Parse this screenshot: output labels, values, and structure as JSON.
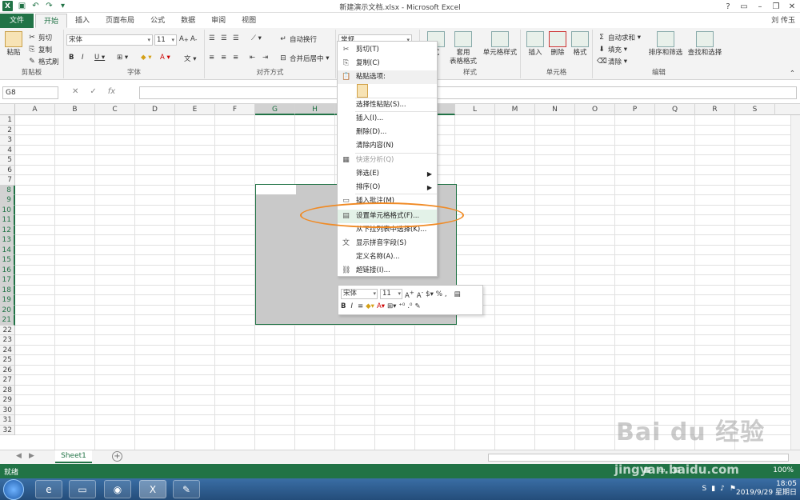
{
  "window": {
    "title": "新建演示文档.xlsx - Microsoft Excel",
    "user": "刘 传玉"
  },
  "tabs": [
    "文件",
    "开始",
    "插入",
    "页面布局",
    "公式",
    "数据",
    "审阅",
    "视图"
  ],
  "ribbon": {
    "clipboard": {
      "paste": "粘贴",
      "cut": "剪切",
      "copy": "复制",
      "format_painter": "格式刷",
      "label": "剪贴板"
    },
    "font": {
      "name": "宋体",
      "size": "11",
      "label": "字体"
    },
    "align": {
      "wrap": "自动换行",
      "merge": "合并后居中",
      "label": "对齐方式"
    },
    "number": {
      "format": "常规"
    },
    "styles": {
      "cond": "式",
      "table": "套用\n表格格式",
      "cell": "单元格样式",
      "label": "样式"
    },
    "cells": {
      "insert": "插入",
      "delete": "删除",
      "format": "格式",
      "label": "单元格"
    },
    "editing": {
      "autosum": "自动求和",
      "fill": "填充",
      "clear": "清除",
      "sort": "排序和筛选",
      "find": "查找和选择",
      "label": "编辑"
    }
  },
  "formula": {
    "namebox": "G8",
    "fx": "fx"
  },
  "columns": [
    "A",
    "B",
    "C",
    "D",
    "E",
    "F",
    "G",
    "H",
    "I",
    "J",
    "K",
    "L",
    "M",
    "N",
    "O",
    "P",
    "Q",
    "R",
    "S"
  ],
  "rows": [
    "1",
    "2",
    "3",
    "4",
    "5",
    "6",
    "7",
    "8",
    "9",
    "10",
    "11",
    "12",
    "13",
    "14",
    "15",
    "16",
    "17",
    "18",
    "19",
    "20",
    "21",
    "22",
    "23",
    "24",
    "25",
    "26",
    "27",
    "28",
    "29",
    "30",
    "31",
    "32"
  ],
  "context_menu": [
    {
      "label": "剪切(T)",
      "icon": "scissors-icon",
      "glyph": "✂",
      "state": "normal"
    },
    {
      "label": "复制(C)",
      "icon": "copy-icon",
      "glyph": "⎘",
      "state": "normal"
    },
    {
      "label": "粘贴选项:",
      "icon": "paste-icon",
      "glyph": "📋",
      "state": "header"
    },
    {
      "label": "选择性粘贴(S)...",
      "icon": "",
      "glyph": "",
      "state": "normal"
    },
    {
      "label": "插入(I)...",
      "icon": "",
      "glyph": "",
      "state": "normal"
    },
    {
      "label": "删除(D)...",
      "icon": "",
      "glyph": "",
      "state": "normal"
    },
    {
      "label": "清除内容(N)",
      "icon": "",
      "glyph": "",
      "state": "normal"
    },
    {
      "label": "快速分析(Q)",
      "icon": "quick-analysis-icon",
      "glyph": "▦",
      "state": "disabled"
    },
    {
      "label": "筛选(E)",
      "icon": "",
      "glyph": "",
      "state": "submenu"
    },
    {
      "label": "排序(O)",
      "icon": "",
      "glyph": "",
      "state": "submenu"
    },
    {
      "label": "插入批注(M)",
      "icon": "comment-icon",
      "glyph": "▭",
      "state": "normal"
    },
    {
      "label": "设置单元格格式(F)...",
      "icon": "format-cells-icon",
      "glyph": "▤",
      "state": "highlight"
    },
    {
      "label": "从下拉列表中选择(K)...",
      "icon": "",
      "glyph": "",
      "state": "normal"
    },
    {
      "label": "显示拼音字段(S)",
      "icon": "phonetic-icon",
      "glyph": "文",
      "state": "normal"
    },
    {
      "label": "定义名称(A)...",
      "icon": "",
      "glyph": "",
      "state": "normal"
    },
    {
      "label": "超链接(I)...",
      "icon": "hyperlink-icon",
      "glyph": "⛓",
      "state": "normal"
    }
  ],
  "mini_toolbar": {
    "font": "宋体",
    "size": "11",
    "percent": "%",
    "comma": ","
  },
  "sheet": {
    "name": "Sheet1"
  },
  "status": {
    "ready": "就绪",
    "zoom": "100%"
  },
  "taskbar": {
    "time": "18:05",
    "date": "2019/9/29 星期日"
  },
  "watermark": {
    "line1": "Bai du 经验",
    "line2": "jingyan.baidu.com"
  }
}
